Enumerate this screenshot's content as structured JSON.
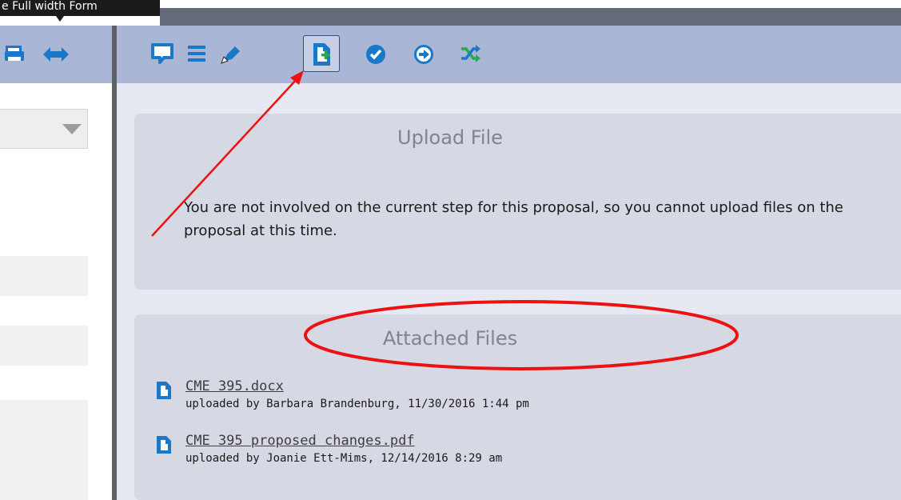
{
  "tooltip": {
    "text": "e Full width Form"
  },
  "toolbar": {
    "left_icons": [
      "print-icon",
      "expand-width-icon"
    ],
    "right_icons": [
      "comment-icon",
      "list-icon",
      "edit-icon",
      "add-file-icon",
      "approve-icon",
      "forward-icon",
      "shuffle-icon"
    ],
    "selected_icon": "add-file-icon"
  },
  "upload_panel": {
    "title": "Upload File",
    "message": "You are not involved on the current step for this proposal, so you cannot upload files on the proposal at this time."
  },
  "attached_panel": {
    "title": "Attached Files",
    "files": [
      {
        "name": "CME 395.docx",
        "meta": "uploaded by Barbara Brandenburg, 11/30/2016 1:44 pm"
      },
      {
        "name": "CME 395 proposed changes.pdf",
        "meta": "uploaded by Joanie Ett-Mims, 12/14/2016 8:29 am"
      }
    ]
  },
  "colors": {
    "toolbar_bg": "#a9b6d6",
    "icon_blue": "#1a78c8",
    "panel_bg": "#d6d9e3",
    "annotation_red": "#ee1111",
    "shuffle_green": "#2aa94a"
  }
}
